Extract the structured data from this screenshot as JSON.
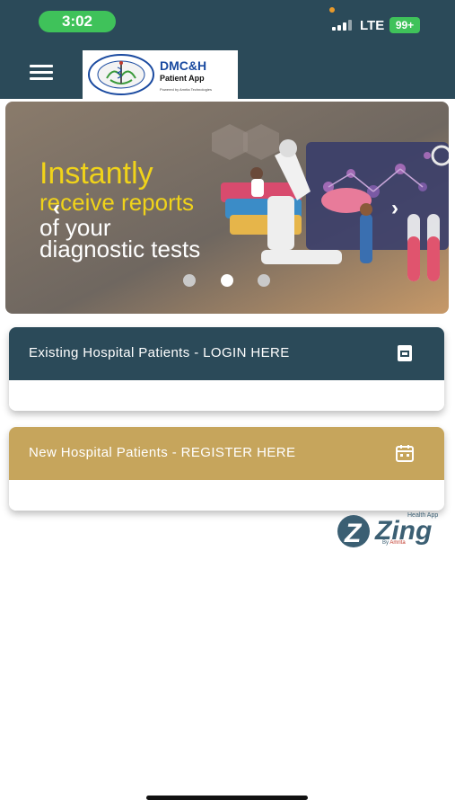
{
  "status_bar": {
    "time": "3:02",
    "network": "LTE",
    "battery": "99+"
  },
  "app_bar": {
    "logo": {
      "title": "DMC&H",
      "subtitle": "Patient App",
      "powered_by": "Powered by Amrita Technologies",
      "seal_text": "DAYANAND MEDICAL COLLEGE & HOSPITAL LUDHIANA"
    }
  },
  "banner": {
    "lines": [
      "Instantly",
      "receive reports",
      "of your",
      "diagnostic tests"
    ],
    "slide_count": 3,
    "active_slide_index": 1
  },
  "cards": [
    {
      "label": "Existing Hospital Patients - LOGIN HERE",
      "icon": "id-card-icon",
      "color": "#2b4a59"
    },
    {
      "label": "New Hospital Patients - REGISTER HERE",
      "icon": "calendar-icon",
      "color": "#c6a55c"
    }
  ],
  "footer_logo": {
    "brand": "Zing",
    "tag": "Health App",
    "by": "By",
    "maker": "Amrita"
  },
  "colors": {
    "header": "#2b4a59",
    "accent_gold": "#c6a55c",
    "headline_yellow": "#f0d31a"
  }
}
